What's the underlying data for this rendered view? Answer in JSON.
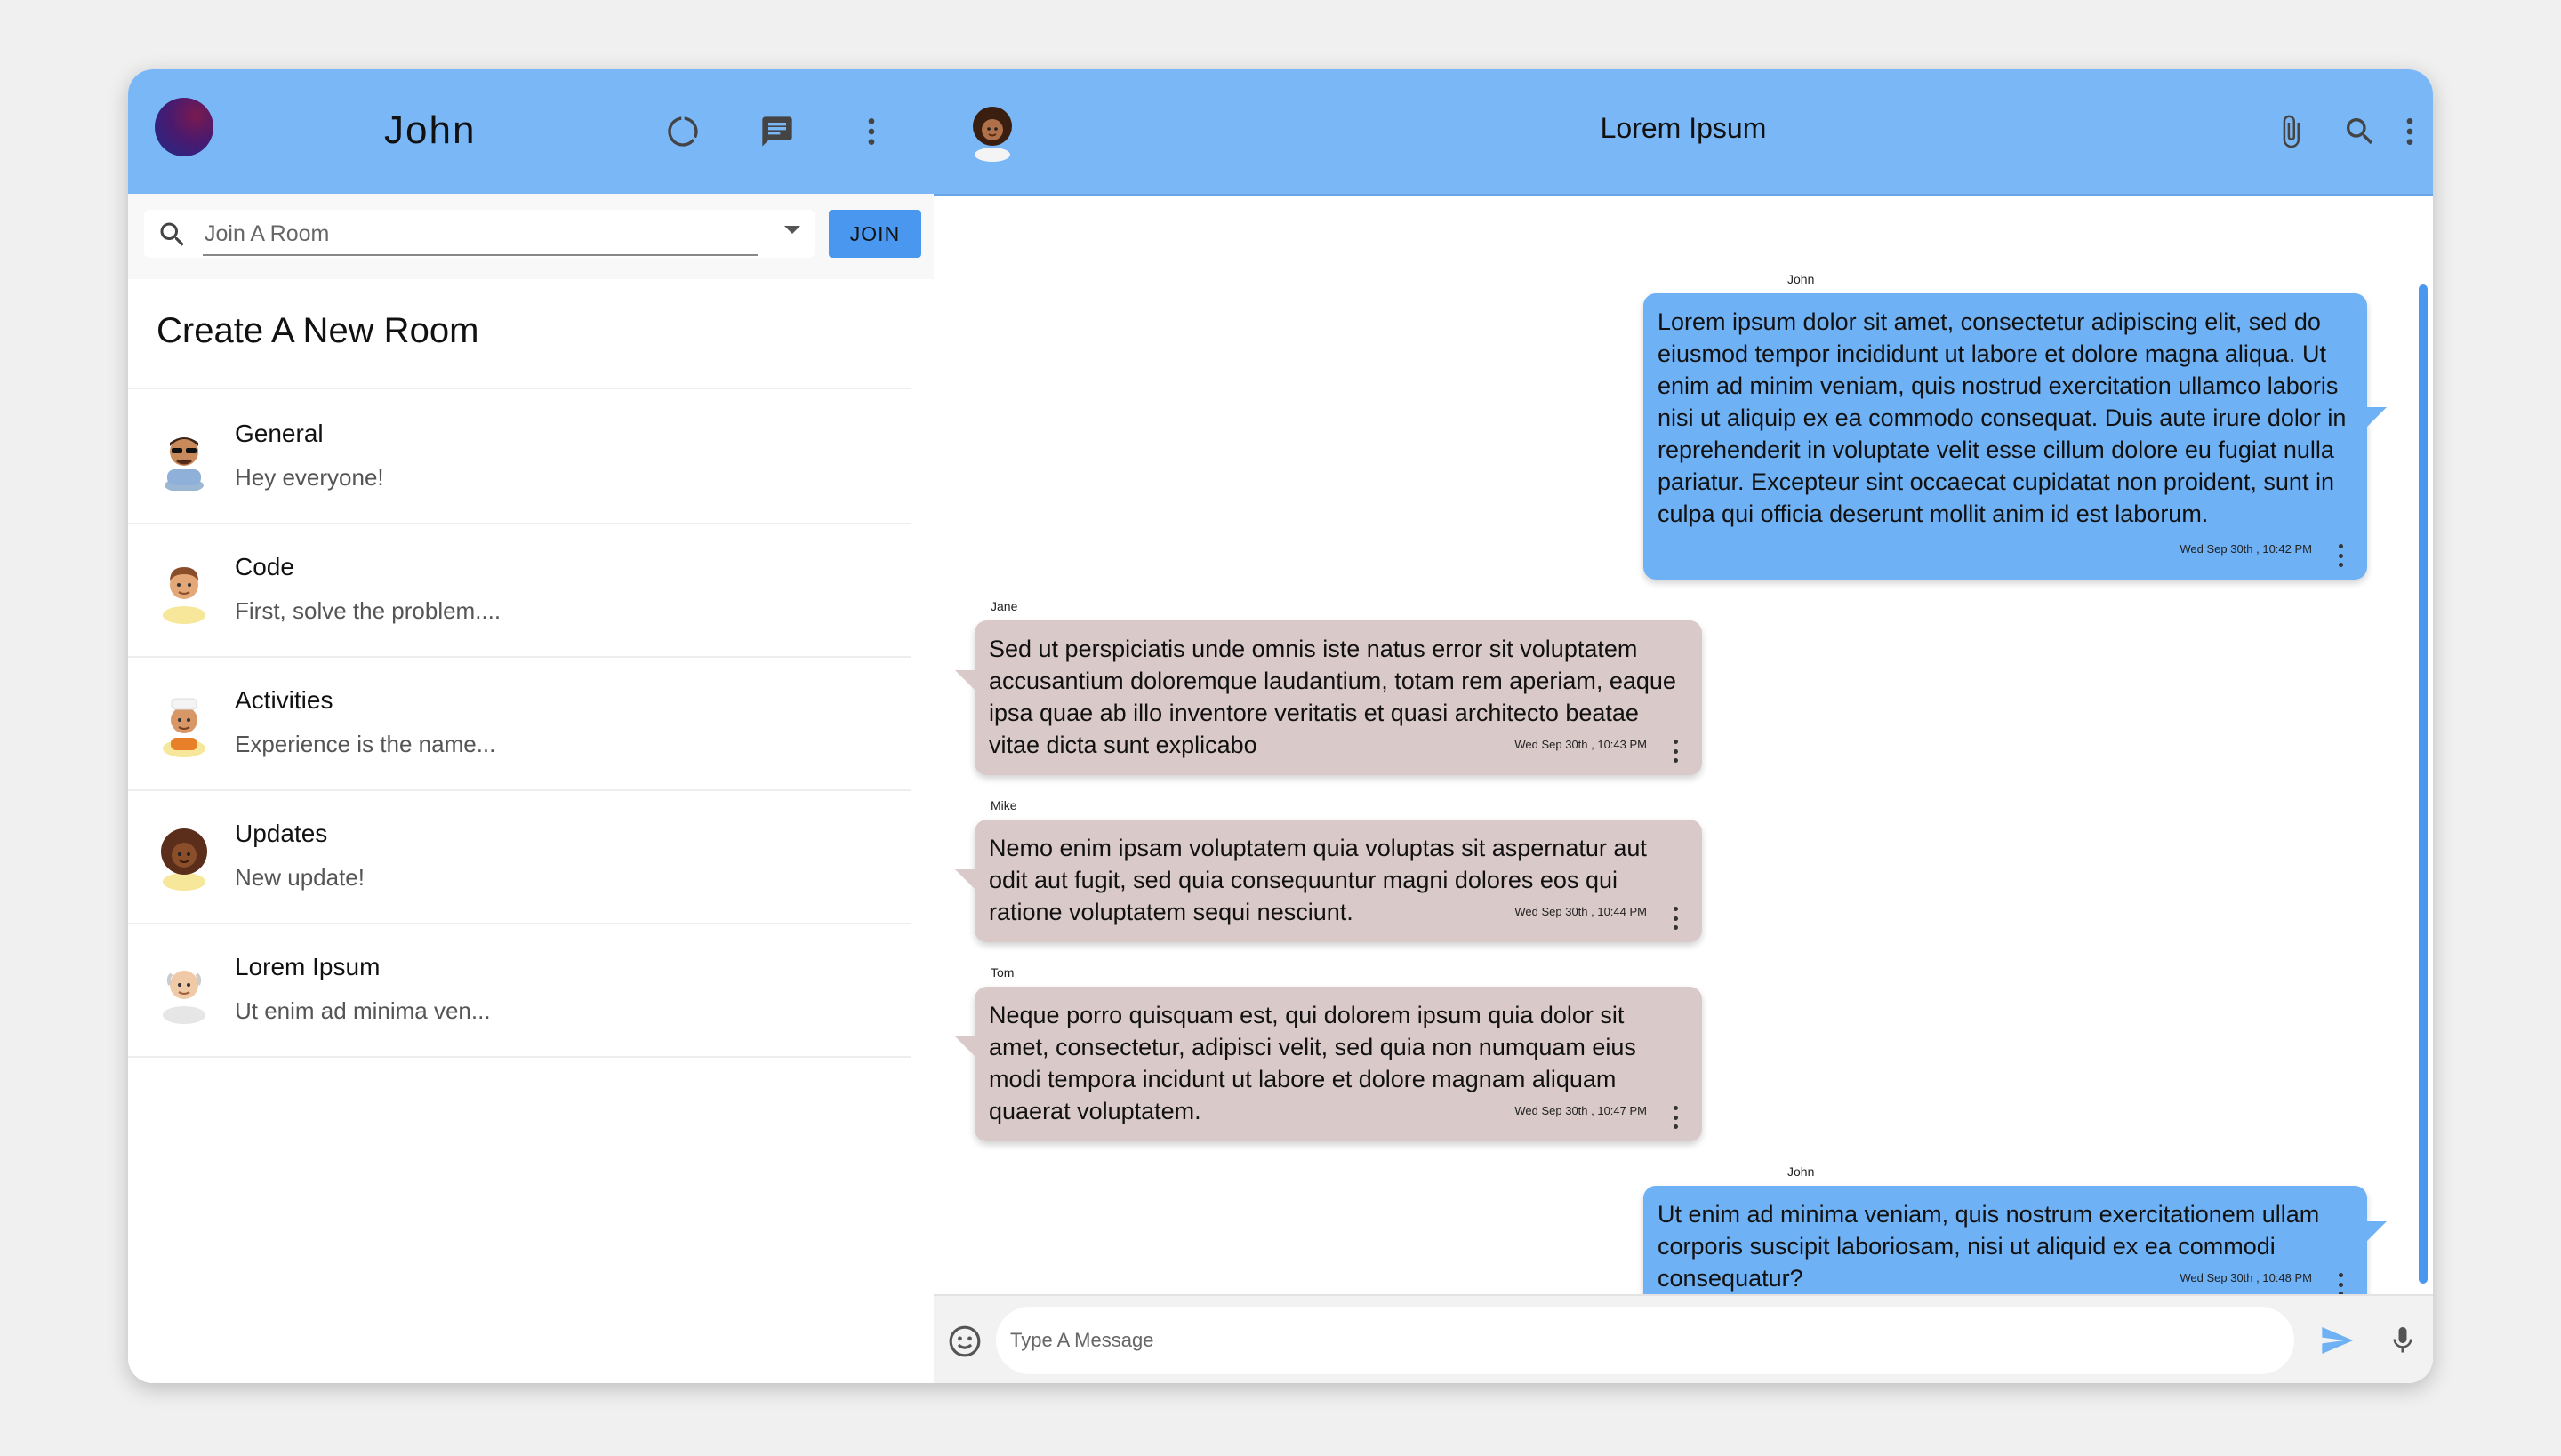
{
  "sidebar": {
    "user_name": "John",
    "search": {
      "placeholder": "Join A Room"
    },
    "join_label": "JOIN",
    "create_room_label": "Create A New Room",
    "rooms": [
      {
        "name": "General",
        "last_message": "Hey everyone!",
        "avatar": "sunglasses-man-avatar"
      },
      {
        "name": "Code",
        "last_message": "First, solve the problem....",
        "avatar": "man-avatar"
      },
      {
        "name": "Activities",
        "last_message": "Experience is the name...",
        "avatar": "chef-avatar"
      },
      {
        "name": "Updates",
        "last_message": "New update!",
        "avatar": "curly-hair-woman-avatar"
      },
      {
        "name": "Lorem Ipsum",
        "last_message": "Ut enim ad minima ven...",
        "avatar": "bald-man-avatar"
      }
    ],
    "icons": [
      "status-icon",
      "chat-icon",
      "more-vert-icon"
    ]
  },
  "chat": {
    "room_title": "Lorem Ipsum",
    "icons": [
      "search-icon",
      "attach-icon",
      "more-vert-icon"
    ],
    "messages": [
      {
        "sender": "John",
        "text": "Lorem ipsum dolor sit amet, consectetur adipiscing elit, sed do eiusmod tempor incididunt ut labore et dolore magna aliqua. Ut enim ad minim veniam, quis nostrud exercitation ullamco laboris nisi ut aliquip ex ea commodo consequat. Duis aute irure dolor in reprehenderit in voluptate velit esse cillum dolore eu fugiat nulla pariatur. Excepteur sint occaecat cupidatat non proident, sunt in culpa qui officia deserunt mollit anim id est laborum.",
        "time": "Wed Sep 30th , 10:42 PM",
        "mine": true
      },
      {
        "sender": "Jane",
        "text": "Sed ut perspiciatis unde omnis iste natus error sit voluptatem accusantium doloremque laudantium, totam rem aperiam, eaque ipsa quae ab illo inventore veritatis et quasi architecto beatae vitae dicta sunt explicabo",
        "time": "Wed Sep 30th , 10:43 PM",
        "mine": false
      },
      {
        "sender": "Mike",
        "text": "Nemo enim ipsam voluptatem quia voluptas sit aspernatur aut odit aut fugit, sed quia consequuntur magni dolores eos qui ratione voluptatem sequi nesciunt.",
        "time": "Wed Sep 30th , 10:44 PM",
        "mine": false
      },
      {
        "sender": "Tom",
        "text": "Neque porro quisquam est, qui dolorem ipsum quia dolor sit amet, consectetur, adipisci velit, sed quia non numquam eius modi tempora incidunt ut labore et dolore magnam aliquam quaerat voluptatem.",
        "time": "Wed Sep 30th , 10:47 PM",
        "mine": false
      },
      {
        "sender": "John",
        "text": "Ut enim ad minima veniam, quis nostrum exercitationem ullam corporis suscipit laboriosam, nisi ut aliquid ex ea commodi consequatur?",
        "time": "Wed Sep 30th , 10:48 PM",
        "mine": true
      }
    ],
    "composer": {
      "placeholder": "Type A Message"
    }
  },
  "colors": {
    "header": "#7ab7f7",
    "accent": "#4a97f0",
    "my_bubble": "#6fb1f5",
    "their_bubble": "#d9c9c9"
  }
}
